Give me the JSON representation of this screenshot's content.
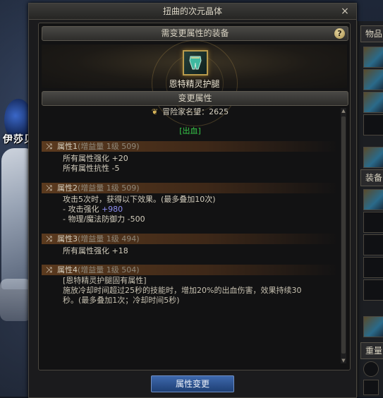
{
  "window": {
    "title": "扭曲的次元晶体",
    "close_glyph": "×"
  },
  "equip_section": {
    "header": "需变更属性的装备",
    "help_glyph": "?",
    "item_name": "恩特精灵护腿",
    "item_icon": "leg-armor-icon"
  },
  "attr_section": {
    "header": "变更属性",
    "fame_label": "冒险家名望：2625",
    "tag": "[出血]"
  },
  "attributes": [
    {
      "label": "属性1",
      "gain": "(增益量 1级 509)",
      "lines": [
        {
          "text": "所有属性强化 +20"
        },
        {
          "text": "所有属性抗性 -5"
        }
      ]
    },
    {
      "label": "属性2",
      "gain": "(增益量 1级 509)",
      "lines": [
        {
          "text": "攻击5次时，获得以下效果。(最多叠加10次)"
        },
        {
          "text": "- 攻击强化 ",
          "highlight": "+980"
        },
        {
          "text": "- 物理/魔法防御力 -500"
        }
      ]
    },
    {
      "label": "属性3",
      "gain": "(增益量 1级 494)",
      "lines": [
        {
          "text": "所有属性强化 +18"
        }
      ]
    },
    {
      "label": "属性4",
      "gain": "(增益量 1级 504)",
      "lines": [
        {
          "text": "[恩特精灵护腿固有属性]"
        },
        {
          "text": "施放冷却时间超过25秒的技能时，增加20%的出血伤害，效果持续30"
        },
        {
          "text": "秒。(最多叠加1次；冷却时间5秒)"
        }
      ]
    }
  ],
  "footer": {
    "change_button": "属性变更"
  },
  "background": {
    "character_name": "伊莎贝",
    "inventory_tab_items": "物品",
    "inventory_tab_equip": "装备",
    "inventory_tab_weight": "重量"
  },
  "colors": {
    "bleed_tag": "#37c94a",
    "highlight_value": "#8e8ef0",
    "button_blue": "#2e5596"
  }
}
